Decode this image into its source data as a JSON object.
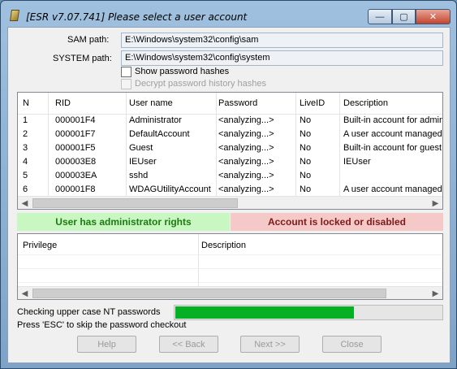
{
  "window": {
    "title": "[ESR v7.07.741]  Please select a user account",
    "minimize": "—",
    "maximize": "▢",
    "close": "✕"
  },
  "paths": {
    "sam_label": "SAM path:",
    "sam_value": "E:\\Windows\\system32\\config\\sam",
    "system_label": "SYSTEM path:",
    "system_value": "E:\\Windows\\system32\\config\\system"
  },
  "options": {
    "show_hashes": "Show password hashes",
    "decrypt_history": "Decrypt password history hashes"
  },
  "users_table": {
    "columns": [
      "N",
      "RID",
      "User name",
      "Password",
      "LiveID",
      "Description"
    ],
    "rows": [
      [
        "1",
        "000001F4",
        "Administrator",
        "<analyzing...>",
        "No",
        "Built-in account for administering"
      ],
      [
        "2",
        "000001F7",
        "DefaultAccount",
        "<analyzing...>",
        "No",
        "A user account managed by"
      ],
      [
        "3",
        "000001F5",
        "Guest",
        "<analyzing...>",
        "No",
        "Built-in account for guest access"
      ],
      [
        "4",
        "000003E8",
        "IEUser",
        "<analyzing...>",
        "No",
        "IEUser"
      ],
      [
        "5",
        "000003EA",
        "sshd",
        "<analyzing...>",
        "No",
        ""
      ],
      [
        "6",
        "000001F8",
        "WDAGUtilityAccount",
        "<analyzing...>",
        "No",
        "A user account managed by"
      ]
    ]
  },
  "status": {
    "admin": "User has administrator rights",
    "locked": "Account is locked or disabled"
  },
  "privileges_table": {
    "columns": [
      "Privilege",
      "Description"
    ]
  },
  "progress": {
    "task": "Checking upper case NT passwords",
    "hint": "Press 'ESC' to skip the password checkout",
    "percent": 67
  },
  "buttons": {
    "help": "Help",
    "back": "<< Back",
    "next": "Next >>",
    "close": "Close"
  }
}
